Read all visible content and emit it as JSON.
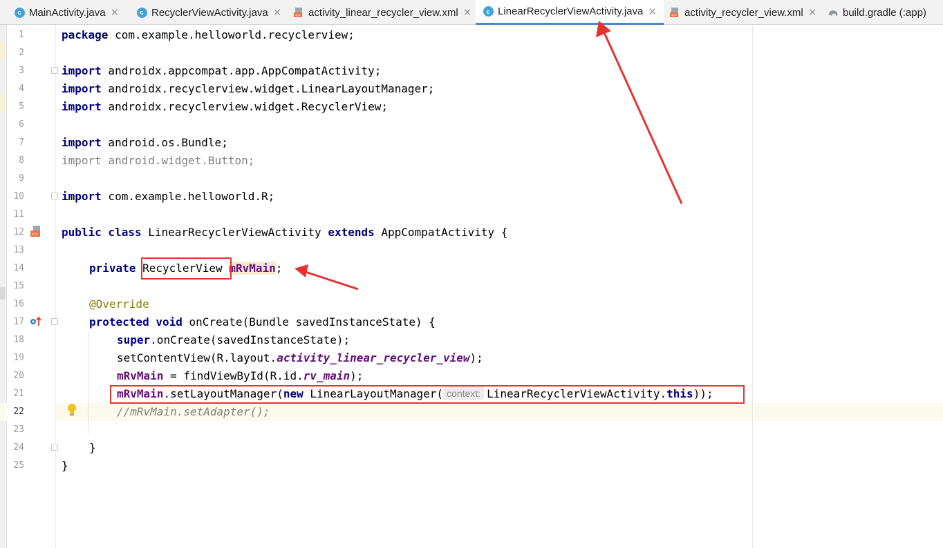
{
  "tabs": [
    {
      "label": "MainActivity.java",
      "icon": "java-class-icon"
    },
    {
      "label": "RecyclerViewActivity.java",
      "icon": "java-class-icon"
    },
    {
      "label": "activity_linear_recycler_view.xml",
      "icon": "xml-file-icon"
    },
    {
      "label": "LinearRecyclerViewActivity.java",
      "icon": "java-class-icon",
      "active": true
    },
    {
      "label": "activity_recycler_view.xml",
      "icon": "xml-file-icon"
    },
    {
      "label": "build.gradle (:app)",
      "icon": "gradle-icon"
    }
  ],
  "line_numbers": [
    "1",
    "2",
    "3",
    "4",
    "5",
    "6",
    "7",
    "8",
    "9",
    "10",
    "11",
    "12",
    "13",
    "14",
    "15",
    "16",
    "17",
    "18",
    "19",
    "20",
    "21",
    "22",
    "23",
    "24",
    "25"
  ],
  "code": {
    "l1": {
      "kw": "package",
      "rest": " com.example.helloworld.recyclerview;"
    },
    "l3": {
      "kw": "import",
      "rest": " androidx.appcompat.app.AppCompatActivity;"
    },
    "l4": {
      "kw": "import",
      "rest": " androidx.recyclerview.widget.LinearLayoutManager;"
    },
    "l5": {
      "kw": "import",
      "rest": " androidx.recyclerview.widget.RecyclerView;"
    },
    "l7": {
      "kw": "import",
      "rest": " android.os.Bundle;"
    },
    "l8": {
      "kw": "import",
      "rest": " android.widget.Button;"
    },
    "l10": {
      "kw": "import",
      "rest": " com.example.helloworld.R;"
    },
    "l12": {
      "kw1": "public class",
      "name": " LinearRecyclerViewActivity ",
      "kw2": "extends",
      "rest": " AppCompatActivity {"
    },
    "l14": {
      "kw": "private",
      "type": "RecyclerView",
      "field": "mRvMain",
      "end": ";"
    },
    "l16": {
      "ann": "@Override"
    },
    "l17": {
      "kw": "protected void",
      "rest": " onCreate(Bundle savedInstanceState) {"
    },
    "l18": {
      "kw": "super",
      "rest": ".onCreate(savedInstanceState);"
    },
    "l19": {
      "pre": "setContentView(R.layout.",
      "ital": "activity_linear_recycler_view",
      "end": ");"
    },
    "l20": {
      "field": "mRvMain",
      "pre": " = findViewById(R.id.",
      "ital": "rv_main",
      "end": ");"
    },
    "l21": {
      "field": "mRvMain",
      "pre": ".setLayoutManager(",
      "kw": "new",
      "mid": " LinearLayoutManager(",
      "hint": "context:",
      "arg": "LinearRecyclerViewActivity.",
      "kw2": "this",
      "end": "));"
    },
    "l22": {
      "comment": "//mRvMain.setAdapter();"
    },
    "l24": {
      "text": "}"
    },
    "l25": {
      "text": "}"
    }
  },
  "colors": {
    "keyword": "#000080",
    "field": "#660e7a",
    "annotation": "#808000",
    "comment": "#808080",
    "highlight_box": "#e53333",
    "active_tab_underline": "#4a88c7"
  },
  "gutter_icons": [
    "class-layout-icon",
    "override-marker-icon",
    "lightbulb-icon"
  ]
}
